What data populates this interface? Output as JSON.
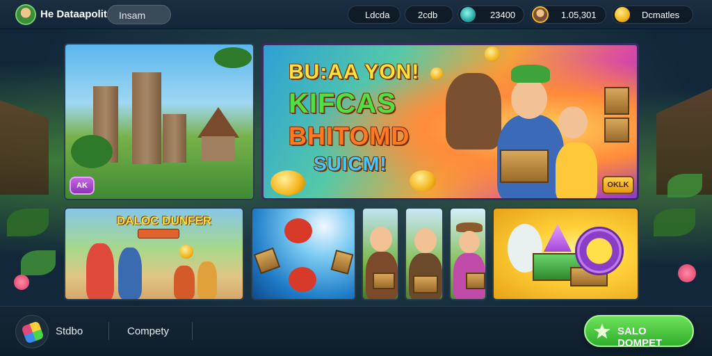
{
  "header": {
    "brand": "He Dataapolita",
    "search_label": "Insam",
    "stats": [
      {
        "label": "Ldcda",
        "icon": "coin-icon"
      },
      {
        "label": "2cdb"
      },
      {
        "label": "23400",
        "icon": "gem-icon"
      },
      {
        "label": "1.05,301",
        "icon": "hero-icon"
      },
      {
        "label": "Dcmatles",
        "icon": "coin-icon"
      }
    ]
  },
  "cards": {
    "castle": {
      "badge": "AK"
    },
    "hero": {
      "line1": "BU:AA YON!",
      "line2": "KIFCAS",
      "line3": "BHITOMD",
      "line4": "SUICM!",
      "badge": "OKLK"
    },
    "village": {
      "title": "DALOC DUNFER"
    }
  },
  "footer": {
    "nav": [
      "Stdbo",
      "Compety"
    ],
    "cta_label": "SALO DOMPET"
  },
  "colors": {
    "cta_green": "#2fae2c",
    "title_yellow": "#ffe23a",
    "title_green": "#4fe045",
    "title_orange": "#ff7a22",
    "title_blue": "#48c8ff"
  }
}
